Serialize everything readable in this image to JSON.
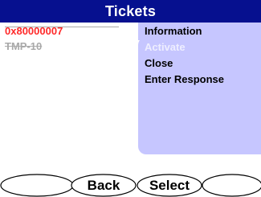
{
  "window": {
    "title": "Tickets"
  },
  "ticket_list": {
    "items": [
      {
        "label": "0x80000007",
        "state": "selected"
      },
      {
        "label": "TMP-10",
        "state": "disabled"
      }
    ]
  },
  "action_menu": {
    "items": [
      {
        "label": "Information",
        "enabled": true
      },
      {
        "label": "Activate",
        "enabled": false
      },
      {
        "label": "Close",
        "enabled": true
      },
      {
        "label": "Enter Response",
        "enabled": true
      }
    ]
  },
  "softkeys": {
    "key1": "",
    "key2": "Back",
    "key3": "Select",
    "key4": ""
  },
  "colors": {
    "titlebar": "#06108f",
    "menu_background": "#c6c6ff",
    "selected_item": "#ff2a2a",
    "disabled_item": "#a9a9a9"
  }
}
